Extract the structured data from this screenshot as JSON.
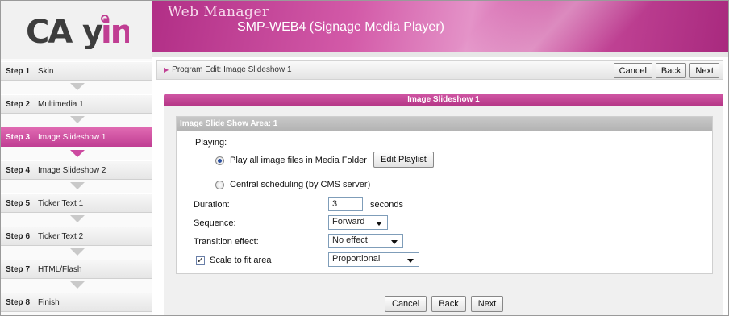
{
  "logo": {
    "text": "CAYIN"
  },
  "banner": {
    "title": "Web Manager",
    "subtitle": "SMP-WEB4 (Signage Media Player)"
  },
  "steps": [
    {
      "num": "Step 1",
      "label": "Skin"
    },
    {
      "num": "Step 2",
      "label": "Multimedia 1"
    },
    {
      "num": "Step 3",
      "label": "Image Slideshow 1"
    },
    {
      "num": "Step 4",
      "label": "Image Slideshow 2"
    },
    {
      "num": "Step 5",
      "label": "Ticker Text 1"
    },
    {
      "num": "Step 6",
      "label": "Ticker Text 2"
    },
    {
      "num": "Step 7",
      "label": "HTML/Flash"
    },
    {
      "num": "Step 8",
      "label": "Finish"
    }
  ],
  "active_step": "Step 3",
  "toolbar": {
    "breadcrumb": "Program Edit: Image Slideshow 1",
    "cancel": "Cancel",
    "back": "Back",
    "next": "Next"
  },
  "panel": {
    "title": "Image Slideshow 1",
    "area_title": "Image Slide Show Area: 1",
    "playing_label": "Playing:",
    "option_media_folder": "Play all image files in Media Folder",
    "edit_playlist": "Edit Playlist",
    "option_cms": "Central scheduling (by CMS server)",
    "duration_label": "Duration:",
    "duration_value": "3",
    "duration_unit": "seconds",
    "sequence_label": "Sequence:",
    "sequence_value": "Forward",
    "transition_label": "Transition effect:",
    "transition_value": "No effect",
    "scale_label": "Scale to fit area",
    "scale_checked": true,
    "scale_value": "Proportional"
  },
  "bottom": {
    "cancel": "Cancel",
    "back": "Back",
    "next": "Next"
  },
  "colors": {
    "accent": "#c03e93",
    "banner": "#b12e86"
  }
}
